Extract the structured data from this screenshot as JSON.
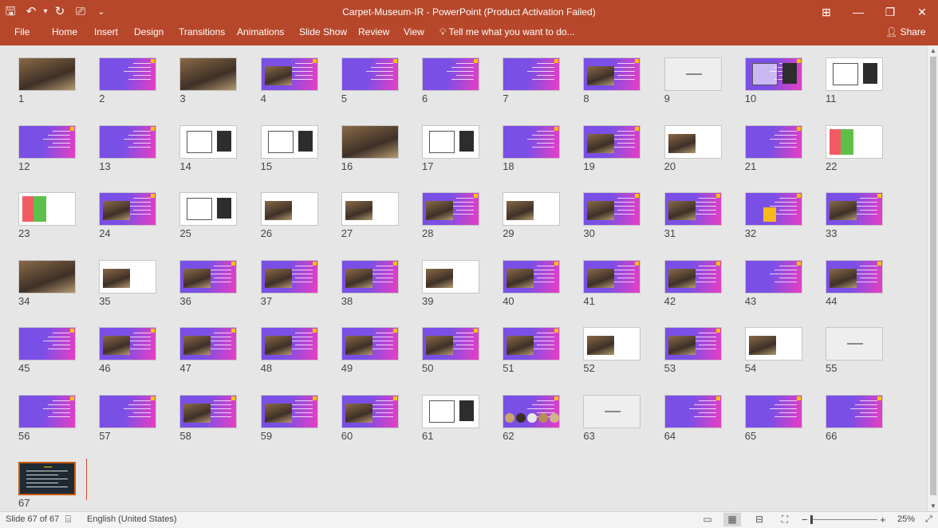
{
  "window": {
    "title": "Carpet-Museum-IR - PowerPoint (Product Activation Failed)",
    "controls": [
      "⊞",
      "—",
      "❐",
      "✕"
    ]
  },
  "qat": {
    "save": "🖫",
    "undo": "↶",
    "undo_dropdown": "▾",
    "redo": "↻",
    "present": "⎚",
    "customize": "⌄"
  },
  "ribbon": {
    "tabs": [
      "File",
      "Home",
      "Insert",
      "Design",
      "Transitions",
      "Animations",
      "Slide Show",
      "Review",
      "View"
    ],
    "tell_me": "Tell me what you want to do...",
    "share": "Share"
  },
  "slides": [
    {
      "num": "1",
      "style": "photo"
    },
    {
      "num": "2",
      "style": "purple"
    },
    {
      "num": "3",
      "style": "photo"
    },
    {
      "num": "4",
      "style": "purple-photo"
    },
    {
      "num": "5",
      "style": "purple"
    },
    {
      "num": "6",
      "style": "purple"
    },
    {
      "num": "7",
      "style": "purple"
    },
    {
      "num": "8",
      "style": "purple-photo"
    },
    {
      "num": "9",
      "style": "blank"
    },
    {
      "num": "10",
      "style": "purple-map"
    },
    {
      "num": "11",
      "style": "white-map"
    },
    {
      "num": "12",
      "style": "purple"
    },
    {
      "num": "13",
      "style": "purple"
    },
    {
      "num": "14",
      "style": "white-diagram"
    },
    {
      "num": "15",
      "style": "white-diagram"
    },
    {
      "num": "16",
      "style": "photo"
    },
    {
      "num": "17",
      "style": "white-diagram"
    },
    {
      "num": "18",
      "style": "purple"
    },
    {
      "num": "19",
      "style": "purple-photo"
    },
    {
      "num": "20",
      "style": "white-photo"
    },
    {
      "num": "21",
      "style": "purple"
    },
    {
      "num": "22",
      "style": "white-colored"
    },
    {
      "num": "23",
      "style": "white-colored"
    },
    {
      "num": "24",
      "style": "purple-photo"
    },
    {
      "num": "25",
      "style": "white-diagram"
    },
    {
      "num": "26",
      "style": "white-photo"
    },
    {
      "num": "27",
      "style": "white-photo"
    },
    {
      "num": "28",
      "style": "purple-photo"
    },
    {
      "num": "29",
      "style": "white-photo"
    },
    {
      "num": "30",
      "style": "purple-photo"
    },
    {
      "num": "31",
      "style": "purple-photo"
    },
    {
      "num": "32",
      "style": "purple-yellow"
    },
    {
      "num": "33",
      "style": "purple-photo"
    },
    {
      "num": "34",
      "style": "photo"
    },
    {
      "num": "35",
      "style": "white-photo"
    },
    {
      "num": "36",
      "style": "purple-photo"
    },
    {
      "num": "37",
      "style": "purple-photo"
    },
    {
      "num": "38",
      "style": "purple-photo"
    },
    {
      "num": "39",
      "style": "white-photo"
    },
    {
      "num": "40",
      "style": "purple-photo"
    },
    {
      "num": "41",
      "style": "purple-photo"
    },
    {
      "num": "42",
      "style": "purple-photo"
    },
    {
      "num": "43",
      "style": "purple"
    },
    {
      "num": "44",
      "style": "purple-photo"
    },
    {
      "num": "45",
      "style": "purple"
    },
    {
      "num": "46",
      "style": "purple-photo"
    },
    {
      "num": "47",
      "style": "purple-photo"
    },
    {
      "num": "48",
      "style": "purple-photo"
    },
    {
      "num": "49",
      "style": "purple-photo"
    },
    {
      "num": "50",
      "style": "purple-photo"
    },
    {
      "num": "51",
      "style": "purple-photo"
    },
    {
      "num": "52",
      "style": "white-photo"
    },
    {
      "num": "53",
      "style": "purple-photo"
    },
    {
      "num": "54",
      "style": "white-photo"
    },
    {
      "num": "55",
      "style": "blank"
    },
    {
      "num": "56",
      "style": "purple"
    },
    {
      "num": "57",
      "style": "purple"
    },
    {
      "num": "58",
      "style": "purple-photo"
    },
    {
      "num": "59",
      "style": "purple-photo"
    },
    {
      "num": "60",
      "style": "purple-photo"
    },
    {
      "num": "61",
      "style": "white-diagram"
    },
    {
      "num": "62",
      "style": "purple-circles"
    },
    {
      "num": "63",
      "style": "blank"
    },
    {
      "num": "64",
      "style": "purple"
    },
    {
      "num": "65",
      "style": "purple"
    },
    {
      "num": "66",
      "style": "purple"
    },
    {
      "num": "67",
      "style": "dark"
    }
  ],
  "status": {
    "slide_info": "Slide 67 of 67",
    "language": "English (United States)",
    "zoom": "25%",
    "zoom_out": "−",
    "zoom_in": "+",
    "view_icons": [
      "▭",
      "▦",
      "⊟",
      "⛶"
    ],
    "notes_icon": "⌸"
  },
  "colors": {
    "accent": "#b7472a",
    "slide_purple_a": "#7a4fe6",
    "slide_purple_b": "#e83ec4",
    "selection": "#c55a11"
  }
}
